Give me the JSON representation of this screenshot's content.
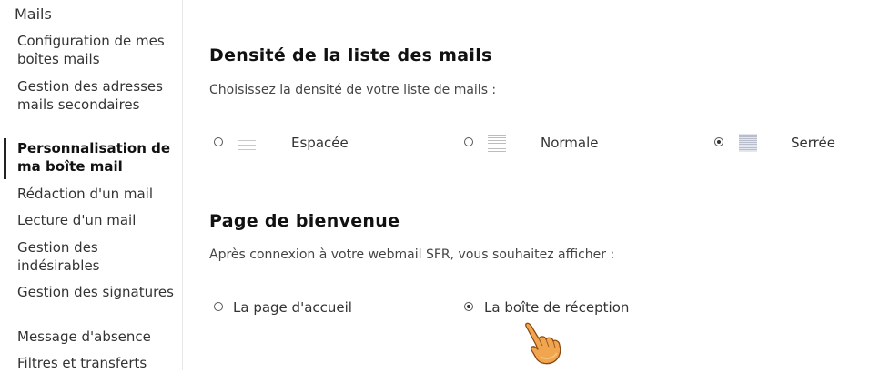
{
  "sidebar": {
    "title": "Mails",
    "items": [
      {
        "label": "Configuration de mes boîtes mails"
      },
      {
        "label": "Gestion des adresses mails secondaires"
      },
      {
        "label": "Personnalisation de ma boîte mail"
      },
      {
        "label": "Rédaction d'un mail"
      },
      {
        "label": "Lecture d'un mail"
      },
      {
        "label": "Gestion des indésirables"
      },
      {
        "label": "Gestion des signatures"
      },
      {
        "label": "Message d'absence"
      },
      {
        "label": "Filtres et transferts"
      }
    ],
    "active_index": 2
  },
  "density": {
    "title": "Densité de la liste des mails",
    "description": "Choisissez la densité de votre liste de mails :",
    "options": [
      {
        "label": "Espacée",
        "selected": false,
        "icon": "spacious-list-icon"
      },
      {
        "label": "Normale",
        "selected": false,
        "icon": "normal-list-icon"
      },
      {
        "label": "Serrée",
        "selected": true,
        "icon": "compact-list-icon"
      }
    ]
  },
  "welcome": {
    "title": "Page de bienvenue",
    "description": "Après connexion à votre webmail SFR, vous souhaitez afficher :",
    "options": [
      {
        "label": "La page d'accueil",
        "selected": false
      },
      {
        "label": "La boîte de réception",
        "selected": true
      }
    ]
  },
  "cursor": {
    "icon": "hand-pointer-cursor-icon"
  }
}
